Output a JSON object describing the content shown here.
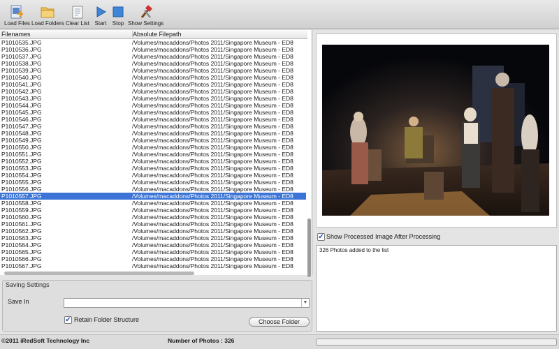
{
  "toolbar": {
    "load_files": "Load Files",
    "load_folders": "Load Folders",
    "clear_list": "Clear List",
    "start": "Start",
    "stop": "Stop",
    "show_settings": "Show Settings"
  },
  "table": {
    "col_filenames": "Filenames",
    "col_path": "Absolute Filepath",
    "rows": [
      {
        "name": "P1010535.JPG",
        "path": "/Volumes/macaddons/Photos 2011/Singapore Museum - ED8"
      },
      {
        "name": "P1010536.JPG",
        "path": "/Volumes/macaddons/Photos 2011/Singapore Museum - ED8"
      },
      {
        "name": "P1010537.JPG",
        "path": "/Volumes/macaddons/Photos 2011/Singapore Museum - ED8"
      },
      {
        "name": "P1010538.JPG",
        "path": "/Volumes/macaddons/Photos 2011/Singapore Museum - ED8"
      },
      {
        "name": "P1010539.JPG",
        "path": "/Volumes/macaddons/Photos 2011/Singapore Museum - ED8"
      },
      {
        "name": "P1010540.JPG",
        "path": "/Volumes/macaddons/Photos 2011/Singapore Museum - ED8"
      },
      {
        "name": "P1010541.JPG",
        "path": "/Volumes/macaddons/Photos 2011/Singapore Museum - ED8"
      },
      {
        "name": "P1010542.JPG",
        "path": "/Volumes/macaddons/Photos 2011/Singapore Museum - ED8"
      },
      {
        "name": "P1010543.JPG",
        "path": "/Volumes/macaddons/Photos 2011/Singapore Museum - ED8"
      },
      {
        "name": "P1010544.JPG",
        "path": "/Volumes/macaddons/Photos 2011/Singapore Museum - ED8"
      },
      {
        "name": "P1010545.JPG",
        "path": "/Volumes/macaddons/Photos 2011/Singapore Museum - ED8"
      },
      {
        "name": "P1010546.JPG",
        "path": "/Volumes/macaddons/Photos 2011/Singapore Museum - ED8"
      },
      {
        "name": "P1010547.JPG",
        "path": "/Volumes/macaddons/Photos 2011/Singapore Museum - ED8"
      },
      {
        "name": "P1010548.JPG",
        "path": "/Volumes/macaddons/Photos 2011/Singapore Museum - ED8"
      },
      {
        "name": "P1010549.JPG",
        "path": "/Volumes/macaddons/Photos 2011/Singapore Museum - ED8"
      },
      {
        "name": "P1010550.JPG",
        "path": "/Volumes/macaddons/Photos 2011/Singapore Museum - ED8"
      },
      {
        "name": "P1010551.JPG",
        "path": "/Volumes/macaddons/Photos 2011/Singapore Museum - ED8"
      },
      {
        "name": "P1010552.JPG",
        "path": "/Volumes/macaddons/Photos 2011/Singapore Museum - ED8"
      },
      {
        "name": "P1010553.JPG",
        "path": "/Volumes/macaddons/Photos 2011/Singapore Museum - ED8"
      },
      {
        "name": "P1010554.JPG",
        "path": "/Volumes/macaddons/Photos 2011/Singapore Museum - ED8"
      },
      {
        "name": "P1010555.JPG",
        "path": "/Volumes/macaddons/Photos 2011/Singapore Museum - ED8"
      },
      {
        "name": "P1010556.JPG",
        "path": "/Volumes/macaddons/Photos 2011/Singapore Museum - ED8"
      },
      {
        "name": "P1010557.JPG",
        "path": "/Volumes/macaddons/Photos 2011/Singapore Museum - ED8"
      },
      {
        "name": "P1010558.JPG",
        "path": "/Volumes/macaddons/Photos 2011/Singapore Museum - ED8"
      },
      {
        "name": "P1010559.JPG",
        "path": "/Volumes/macaddons/Photos 2011/Singapore Museum - ED8"
      },
      {
        "name": "P1010560.JPG",
        "path": "/Volumes/macaddons/Photos 2011/Singapore Museum - ED8"
      },
      {
        "name": "P1010561.JPG",
        "path": "/Volumes/macaddons/Photos 2011/Singapore Museum - ED8"
      },
      {
        "name": "P1010562.JPG",
        "path": "/Volumes/macaddons/Photos 2011/Singapore Museum - ED8"
      },
      {
        "name": "P1010563.JPG",
        "path": "/Volumes/macaddons/Photos 2011/Singapore Museum - ED8"
      },
      {
        "name": "P1010564.JPG",
        "path": "/Volumes/macaddons/Photos 2011/Singapore Museum - ED8"
      },
      {
        "name": "P1010565.JPG",
        "path": "/Volumes/macaddons/Photos 2011/Singapore Museum - ED8"
      },
      {
        "name": "P1010566.JPG",
        "path": "/Volumes/macaddons/Photos 2011/Singapore Museum - ED8"
      },
      {
        "name": "P1010567.JPG",
        "path": "/Volumes/macaddons/Photos 2011/Singapore Museum - ED8"
      }
    ],
    "selected_row": "P1010557.JPG"
  },
  "saving": {
    "title": "Saving Settings",
    "save_in_label": "Save In",
    "save_in_value": "",
    "retain_label": "Retain Folder Structure",
    "retain_checked": true,
    "choose_folder": "Choose Folder"
  },
  "preview": {
    "show_processed_label": "Show Processed Image After Processing",
    "show_processed_checked": true,
    "log_text": "326 Photos added to the list"
  },
  "status": {
    "copyright": "©2011 iRedSoft Technology Inc",
    "photo_count": "Number of Photos : 326",
    "progress_fraction": 0
  },
  "colors": {
    "selection": "#3b74d6",
    "toolbar_bg": "#d9d9d9"
  },
  "icons": [
    "load-files-icon",
    "load-folders-icon",
    "clear-list-icon",
    "start-icon",
    "stop-icon",
    "show-settings-icon",
    "checkmark-icon",
    "dropdown-arrow-icon"
  ]
}
